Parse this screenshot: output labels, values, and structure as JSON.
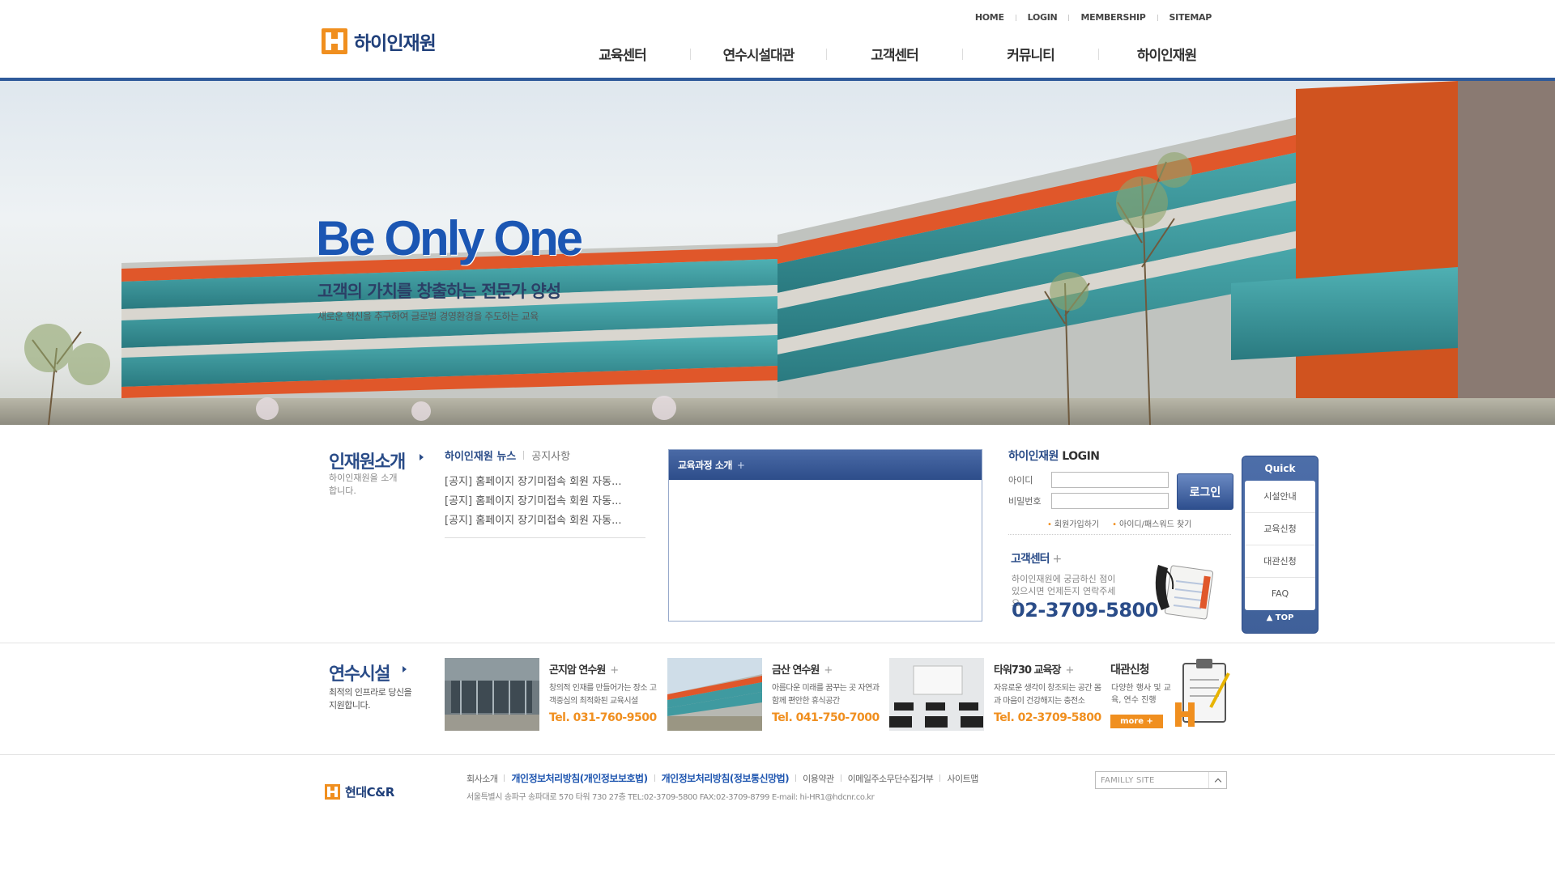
{
  "site": {
    "logo_text": "하이인재원"
  },
  "utility": [
    "HOME",
    "LOGIN",
    "MEMBERSHIP",
    "SITEMAP"
  ],
  "gnb": [
    "교육센터",
    "연수시설대관",
    "고객센터",
    "커뮤니티",
    "하이인재원"
  ],
  "hero": {
    "title": "Be Only One",
    "subtitle": "고객의 가치를 창출하는 전문가 양성",
    "desc": "새로운 혁신을 추구하여 글로벌 경영환경을 주도하는 교육"
  },
  "intro": {
    "title": "인재원소개",
    "desc": "하이인재원을 소개합니다."
  },
  "news": {
    "tab_active": "하이인재원 뉴스",
    "tab_inactive": "공지사항",
    "items": [
      "[공지] 홈페이지 장기미접속 회원 자동...",
      "[공지] 홈페이지 장기미접속 회원 자동...",
      "[공지] 홈페이지 장기미접속 회원 자동..."
    ]
  },
  "course": {
    "title": "교육과정 소개",
    "plus": "+"
  },
  "login": {
    "title_prefix": "하이인재원",
    "title_suffix": "LOGIN",
    "id_label": "아이디",
    "pw_label": "비밀번호",
    "id_value": "",
    "pw_value": "",
    "button": "로그인",
    "join": "회원가입하기",
    "find": "아이디/패스워드 찾기"
  },
  "customer": {
    "title": "고객센터",
    "plus": "+",
    "desc": "하이인재원에 궁금하신 점이 있으시면 언제든지 연락주세요.",
    "phone": "02-3709-5800"
  },
  "quick": {
    "title": "Quick",
    "items": [
      "시설안내",
      "교육신청",
      "대관신청",
      "FAQ"
    ],
    "top": "▲ TOP"
  },
  "facilities": {
    "title": "연수시설",
    "desc": "최적의 인프라로 당신을 지원합니다.",
    "cards": [
      {
        "name": "곤지암 연수원",
        "plus": "+",
        "text": "창의적 인재를 만들어가는 장소 고객중심의 최적화된 교육시설",
        "tel": "Tel. 031-760-9500"
      },
      {
        "name": "금산 연수원",
        "plus": "+",
        "text": "아름다운 미래를 꿈꾸는 곳 자연과 함께 편안한 휴식공간",
        "tel": "Tel. 041-750-7000"
      },
      {
        "name": "타워730 교육장",
        "plus": "+",
        "text": "자유로운 생각이 창조되는 공간 몸과 마음이 건강해지는 충전소",
        "tel": "Tel. 02-3709-5800"
      }
    ],
    "rent_title": "대관신청",
    "rent_desc": "다양한 행사 및 교육, 연수 진행",
    "more": "more +"
  },
  "footer": {
    "logo_text": "현대C&R",
    "links": [
      {
        "label": "회사소개",
        "strong": false
      },
      {
        "label": "개인정보처리방침(개인정보보호법)",
        "strong": true
      },
      {
        "label": "개인정보처리방침(정보통신망법)",
        "strong": true
      },
      {
        "label": "이용약관",
        "strong": false
      },
      {
        "label": "이메일주소무단수집거부",
        "strong": false
      },
      {
        "label": "사이트맵",
        "strong": false
      }
    ],
    "address": "서울특별시 송파구 송파대로 570 타워 730 27층 TEL:02-3709-5800 FAX:02-3709-8799 E-mail: hi-HR1@hdcnr.co.kr",
    "family_site": "FAMILLY SITE"
  },
  "colors": {
    "brand_blue": "#2a4c88",
    "brand_orange": "#f08f1f"
  }
}
